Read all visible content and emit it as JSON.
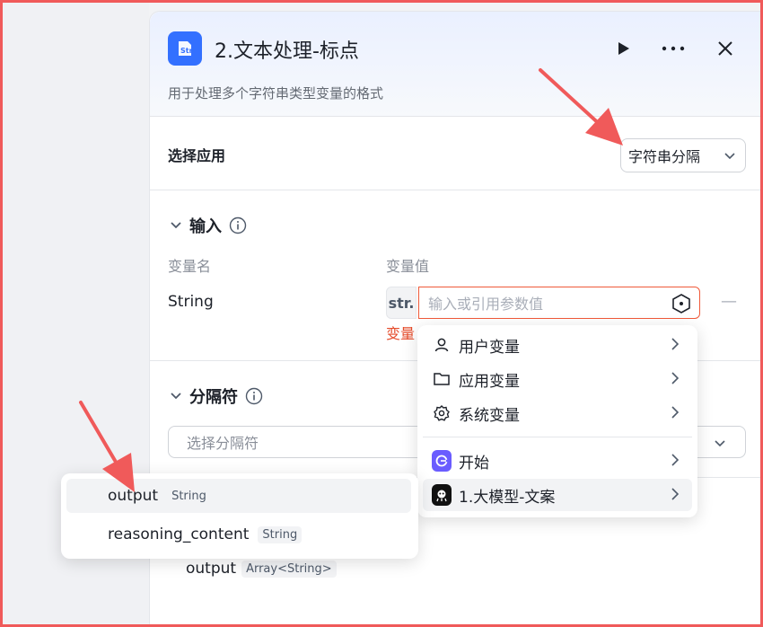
{
  "node": {
    "title": "2.文本处理-标点",
    "description": "用于处理多个字符串类型变量的格式",
    "icon": "str-node-icon",
    "icon_text": "Str"
  },
  "header_actions": [
    "run-icon",
    "more-icon",
    "close-icon"
  ],
  "app_select": {
    "label": "选择应用",
    "value": "字符串分隔"
  },
  "input_section": {
    "title": "输入",
    "col_name": "变量名",
    "col_value": "变量值",
    "rows": [
      {
        "name": "String",
        "type_tag": "str.",
        "placeholder": "输入或引用参数值",
        "error": "变量"
      }
    ]
  },
  "separator_section": {
    "title": "分隔符",
    "placeholder": "选择分隔符"
  },
  "output": {
    "name": "output",
    "type": "Array<String>"
  },
  "ref_menu": {
    "groups": [
      {
        "label": "用户变量",
        "icon": "user-icon"
      },
      {
        "label": "应用变量",
        "icon": "folder-icon"
      },
      {
        "label": "系统变量",
        "icon": "gear-icon"
      }
    ],
    "nodes": [
      {
        "label": "开始",
        "icon": "start-node-icon"
      },
      {
        "label": "1.大模型-文案",
        "icon": "llm-node-icon"
      }
    ]
  },
  "ref_submenu": {
    "items": [
      {
        "name": "output",
        "type": "String"
      },
      {
        "name": "reasoning_content",
        "type": "String"
      }
    ]
  },
  "colors": {
    "accent": "#3370ff",
    "error": "#e54b2a",
    "annotation": "#f05a5a"
  }
}
